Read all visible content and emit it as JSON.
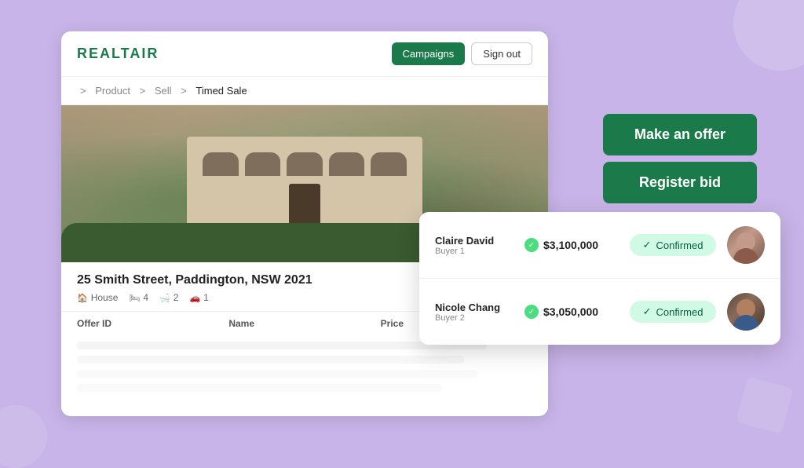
{
  "brand": {
    "logo": "REALTAIR"
  },
  "navbar": {
    "campaigns_label": "Campaigns",
    "signout_label": "Sign out"
  },
  "breadcrumb": {
    "sep": ">",
    "items": [
      "Product",
      "Sell",
      "Timed Sale"
    ]
  },
  "property": {
    "address": "25 Smith Street, Paddington, NSW 2021",
    "type": "House",
    "beds": "4",
    "baths": "2",
    "parking": "1"
  },
  "table": {
    "col1": "Offer ID",
    "col2": "Name",
    "col3": "Price"
  },
  "actions": {
    "make_offer": "Make an offer",
    "register_bid": "Register bid"
  },
  "offers": [
    {
      "buyer_name": "Claire David",
      "buyer_role": "Buyer 1",
      "price": "$3,100,000",
      "status": "Confirmed"
    },
    {
      "buyer_name": "Nicole Chang",
      "buyer_role": "Buyer 2",
      "price": "$3,050,000",
      "status": "Confirmed"
    }
  ],
  "colors": {
    "primary": "#1a7a4a",
    "confirmed_bg": "#d1fae5",
    "confirmed_text": "#065f46"
  }
}
